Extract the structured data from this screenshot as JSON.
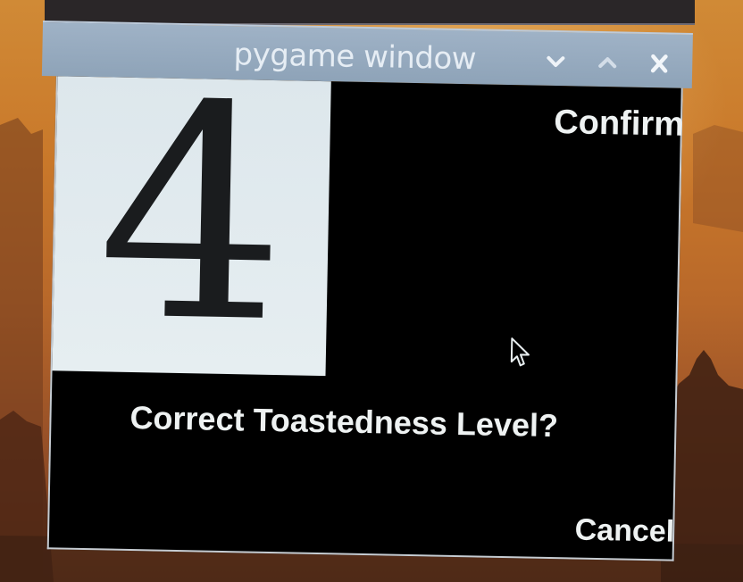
{
  "window": {
    "title": "pygame window",
    "controls": {
      "minimize_icon": "chevron-down-icon",
      "maximize_icon": "chevron-up-icon",
      "close_icon": "close-icon"
    }
  },
  "dialog": {
    "level_value": "4",
    "confirm_label": "Confirm",
    "question": "Correct Toastedness Level?",
    "cancel_label": "Cancel"
  },
  "colors": {
    "titlebar": "#8ea3b8",
    "dialog_background": "#000000",
    "number_panel": "#e0e9ed",
    "text": "#eef2f2"
  }
}
